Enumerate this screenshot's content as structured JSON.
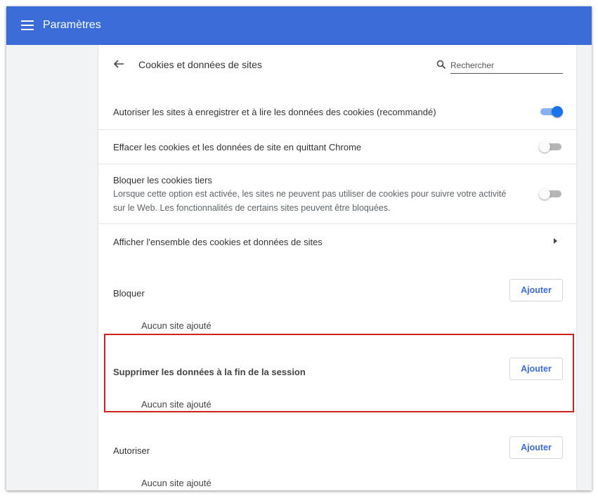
{
  "app": {
    "title": "Paramètres"
  },
  "page": {
    "title": "Cookies et données de sites",
    "search_placeholder": "Rechercher"
  },
  "settings": [
    {
      "label": "Autoriser les sites à enregistrer et à lire les données des cookies (recommandé)",
      "enabled": true
    },
    {
      "label": "Effacer les cookies et les données de site en quittant Chrome",
      "enabled": false
    },
    {
      "label": "Bloquer les cookies tiers",
      "description_line1": "Lorsque cette option est activée, les sites ne peuvent pas utiliser de cookies pour suivre votre activité",
      "description_line2": "sur le Web. Les fonctionnalités de certains sites peuvent être bloquées.",
      "enabled": false
    },
    {
      "label": "Afficher l'ensemble des cookies et données de sites"
    }
  ],
  "sections": [
    {
      "title": "Bloquer",
      "add_label": "Ajouter",
      "empty_text": "Aucun site ajouté"
    },
    {
      "title": "Supprimer les données à la fin de la session",
      "add_label": "Ajouter",
      "empty_text": "Aucun site ajouté"
    },
    {
      "title": "Autoriser",
      "add_label": "Ajouter",
      "empty_text": "Aucun site ajouté"
    }
  ],
  "colors": {
    "header": "#3b6cd8",
    "toggle_on": "#1a73e8",
    "highlight": "#d02020"
  }
}
